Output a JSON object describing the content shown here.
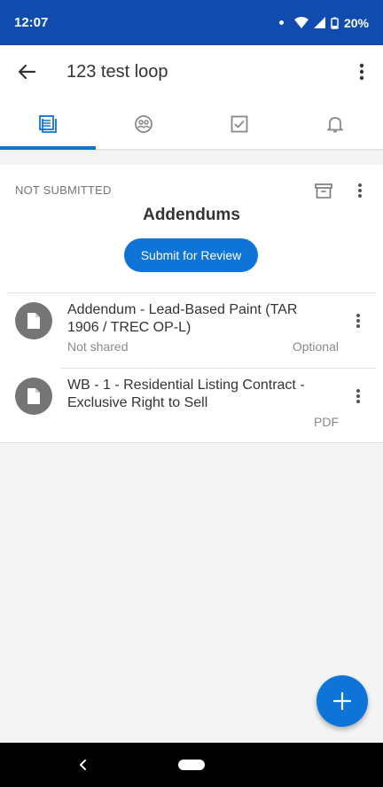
{
  "status_bar": {
    "time": "12:07",
    "battery": "20%"
  },
  "app_bar": {
    "title": "123 test loop",
    "icons": [
      "back-arrow-icon",
      "more-vertical-icon"
    ]
  },
  "tabs": [
    {
      "icon": "documents-icon",
      "active": true
    },
    {
      "icon": "people-icon",
      "active": false
    },
    {
      "icon": "tasks-checkbox-icon",
      "active": false
    },
    {
      "icon": "bell-icon",
      "active": false
    }
  ],
  "folder": {
    "status": "NOT SUBMITTED",
    "title": "Addendums",
    "submit_label": "Submit for Review",
    "documents": [
      {
        "name": "Addendum - Lead-Based Paint (TAR 1906 / TREC OP-L)",
        "sub": "Not shared",
        "tag": "Optional"
      },
      {
        "name": "WB - 1 - Residential Listing Contract - Exclusive Right to Sell",
        "sub": "",
        "tag": "PDF"
      }
    ]
  },
  "colors": {
    "status_bar": "#0f4cad",
    "accent": "#0f74d8",
    "icon_gray": "#757575"
  }
}
